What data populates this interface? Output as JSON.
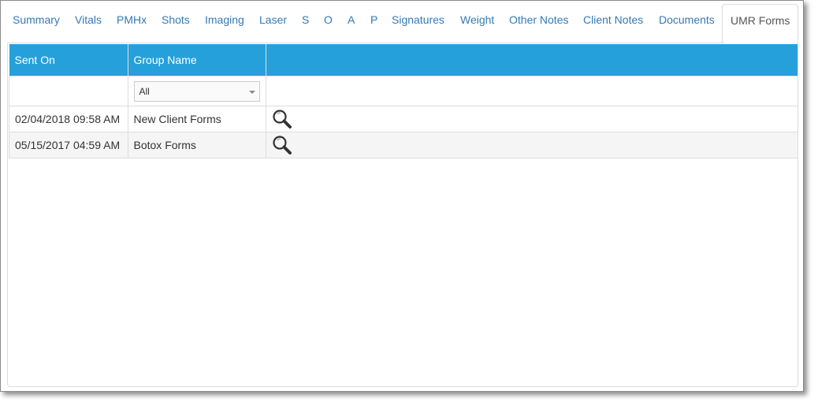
{
  "tabs": [
    {
      "label": "Summary",
      "active": false
    },
    {
      "label": "Vitals",
      "active": false
    },
    {
      "label": "PMHx",
      "active": false
    },
    {
      "label": "Shots",
      "active": false
    },
    {
      "label": "Imaging",
      "active": false
    },
    {
      "label": "Laser",
      "active": false
    },
    {
      "label": "S",
      "active": false
    },
    {
      "label": "O",
      "active": false
    },
    {
      "label": "A",
      "active": false
    },
    {
      "label": "P",
      "active": false
    },
    {
      "label": "Signatures",
      "active": false
    },
    {
      "label": "Weight",
      "active": false
    },
    {
      "label": "Other Notes",
      "active": false
    },
    {
      "label": "Client Notes",
      "active": false
    },
    {
      "label": "Documents",
      "active": false
    },
    {
      "label": "UMR Forms",
      "active": true
    }
  ],
  "table": {
    "columns": [
      "Sent On",
      "Group Name",
      ""
    ],
    "filter": {
      "group_name_selected": "All"
    },
    "rows": [
      {
        "sent_on": "02/04/2018 09:58 AM",
        "group_name": "New Client Forms",
        "action_icon": "magnifier-icon"
      },
      {
        "sent_on": "05/15/2017 04:59 AM",
        "group_name": "Botox Forms",
        "action_icon": "magnifier-icon"
      }
    ]
  },
  "colors": {
    "header_bg": "#26a0da",
    "tab_link": "#337ab7"
  }
}
